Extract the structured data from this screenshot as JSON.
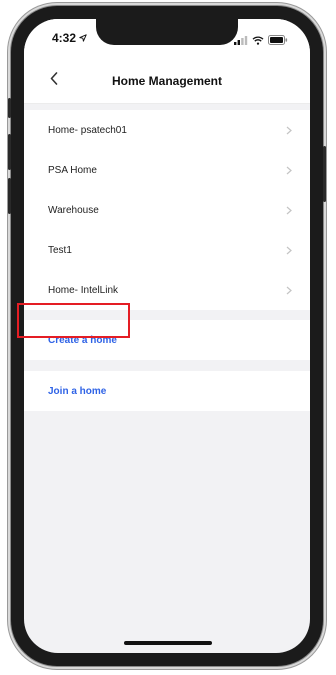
{
  "status_bar": {
    "time": "4:32",
    "location_icon": "location-arrow-icon",
    "signal_icon": "cellular-signal-icon",
    "wifi_icon": "wifi-icon",
    "battery_icon": "battery-icon"
  },
  "nav": {
    "title": "Home Management",
    "back_icon": "chevron-left-icon"
  },
  "homes": [
    {
      "label": "Home- psatech01"
    },
    {
      "label": "PSA Home"
    },
    {
      "label": "Warehouse"
    },
    {
      "label": "Test1"
    },
    {
      "label": "Home- IntelLink"
    }
  ],
  "actions": {
    "create_label": "Create a home",
    "join_label": "Join a home"
  },
  "colors": {
    "accent": "#2f63e6",
    "highlight": "#e41d24",
    "background": "#f2f2f4"
  }
}
